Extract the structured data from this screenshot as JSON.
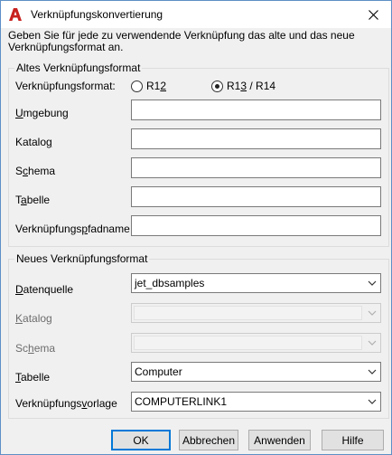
{
  "window": {
    "title": "Verknüpfungskonvertierung",
    "intro": "Geben Sie für jede zu verwendende Verknüpfung das alte und das neue Verknüpfungsformat an."
  },
  "old_format": {
    "legend": "Altes Verknüpfungsformat",
    "format_label": "Verknüpfungsformat:",
    "options": [
      {
        "label": "R12",
        "selected": false
      },
      {
        "label": "R13 / R14",
        "selected": true
      }
    ],
    "fields": [
      {
        "label": "Umgebung",
        "value": ""
      },
      {
        "label": "Katalog",
        "value": ""
      },
      {
        "label": "Schema",
        "value": ""
      },
      {
        "label": "Tabelle",
        "value": ""
      },
      {
        "label": "Verknüpfungspfadname",
        "value": ""
      }
    ]
  },
  "new_format": {
    "legend": "Neues Verknüpfungsformat",
    "fields": [
      {
        "label": "Datenquelle",
        "value": "jet_dbsamples",
        "enabled": true
      },
      {
        "label": "Katalog",
        "value": "",
        "enabled": false
      },
      {
        "label": "Schema",
        "value": "",
        "enabled": false
      },
      {
        "label": "Tabelle",
        "value": "Computer",
        "enabled": true
      },
      {
        "label": "Verknüpfungsvorlage",
        "value": "COMPUTERLINK1",
        "enabled": true
      }
    ]
  },
  "buttons": {
    "ok": "OK",
    "cancel": "Abbrechen",
    "apply": "Anwenden",
    "help": "Hilfe"
  },
  "colors": {
    "accent": "#0078d7",
    "app_icon": "#c8211e"
  }
}
